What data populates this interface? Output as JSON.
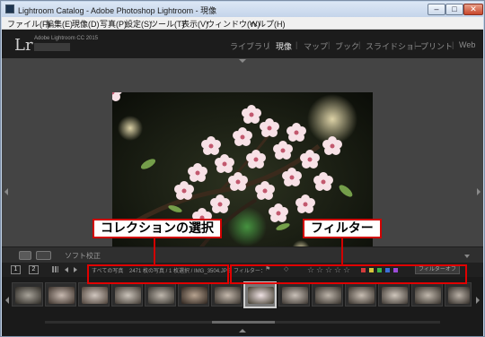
{
  "window": {
    "title": "Lightroom Catalog - Adobe Photoshop Lightroom - 現像",
    "minimize_glyph": "‒",
    "maximize_glyph": "□",
    "close_glyph": "✕"
  },
  "menu": [
    "ファイル(F)",
    "編集(E)",
    "現像(D)",
    "写真(P)",
    "設定(S)",
    "ツール(T)",
    "表示(V)",
    "ウィンドウ(W)",
    "ヘルプ(H)"
  ],
  "app": {
    "logo": "Lr",
    "version": "Adobe Lightroom CC 2015",
    "modules": [
      "ライブラリ",
      "現像",
      "マップ",
      "ブック",
      "スライドショー",
      "プリント",
      "Web"
    ],
    "active_module": "現像"
  },
  "toolbar": {
    "view_label": "ソフト校正"
  },
  "filmbar": {
    "page1": "1",
    "page2": "2",
    "source": "すべての写真",
    "count": "2471 枚の写真 / 1 枚選択 / IMG_3504.JPG",
    "filter_label": "フィルター：",
    "stars": [
      "☆",
      "☆",
      "☆",
      "☆",
      "☆"
    ],
    "filter_off": "フィルターオフ",
    "color_labels": [
      "#d43b3b",
      "#d6c43b",
      "#3bb54a",
      "#3b6fd6",
      "#9b4bd6"
    ]
  },
  "callouts": {
    "collection": "コレクションの選択",
    "filter": "フィルター"
  },
  "colors": {
    "highlight": "#e00000",
    "dark_bg": "#2b2b2b"
  }
}
